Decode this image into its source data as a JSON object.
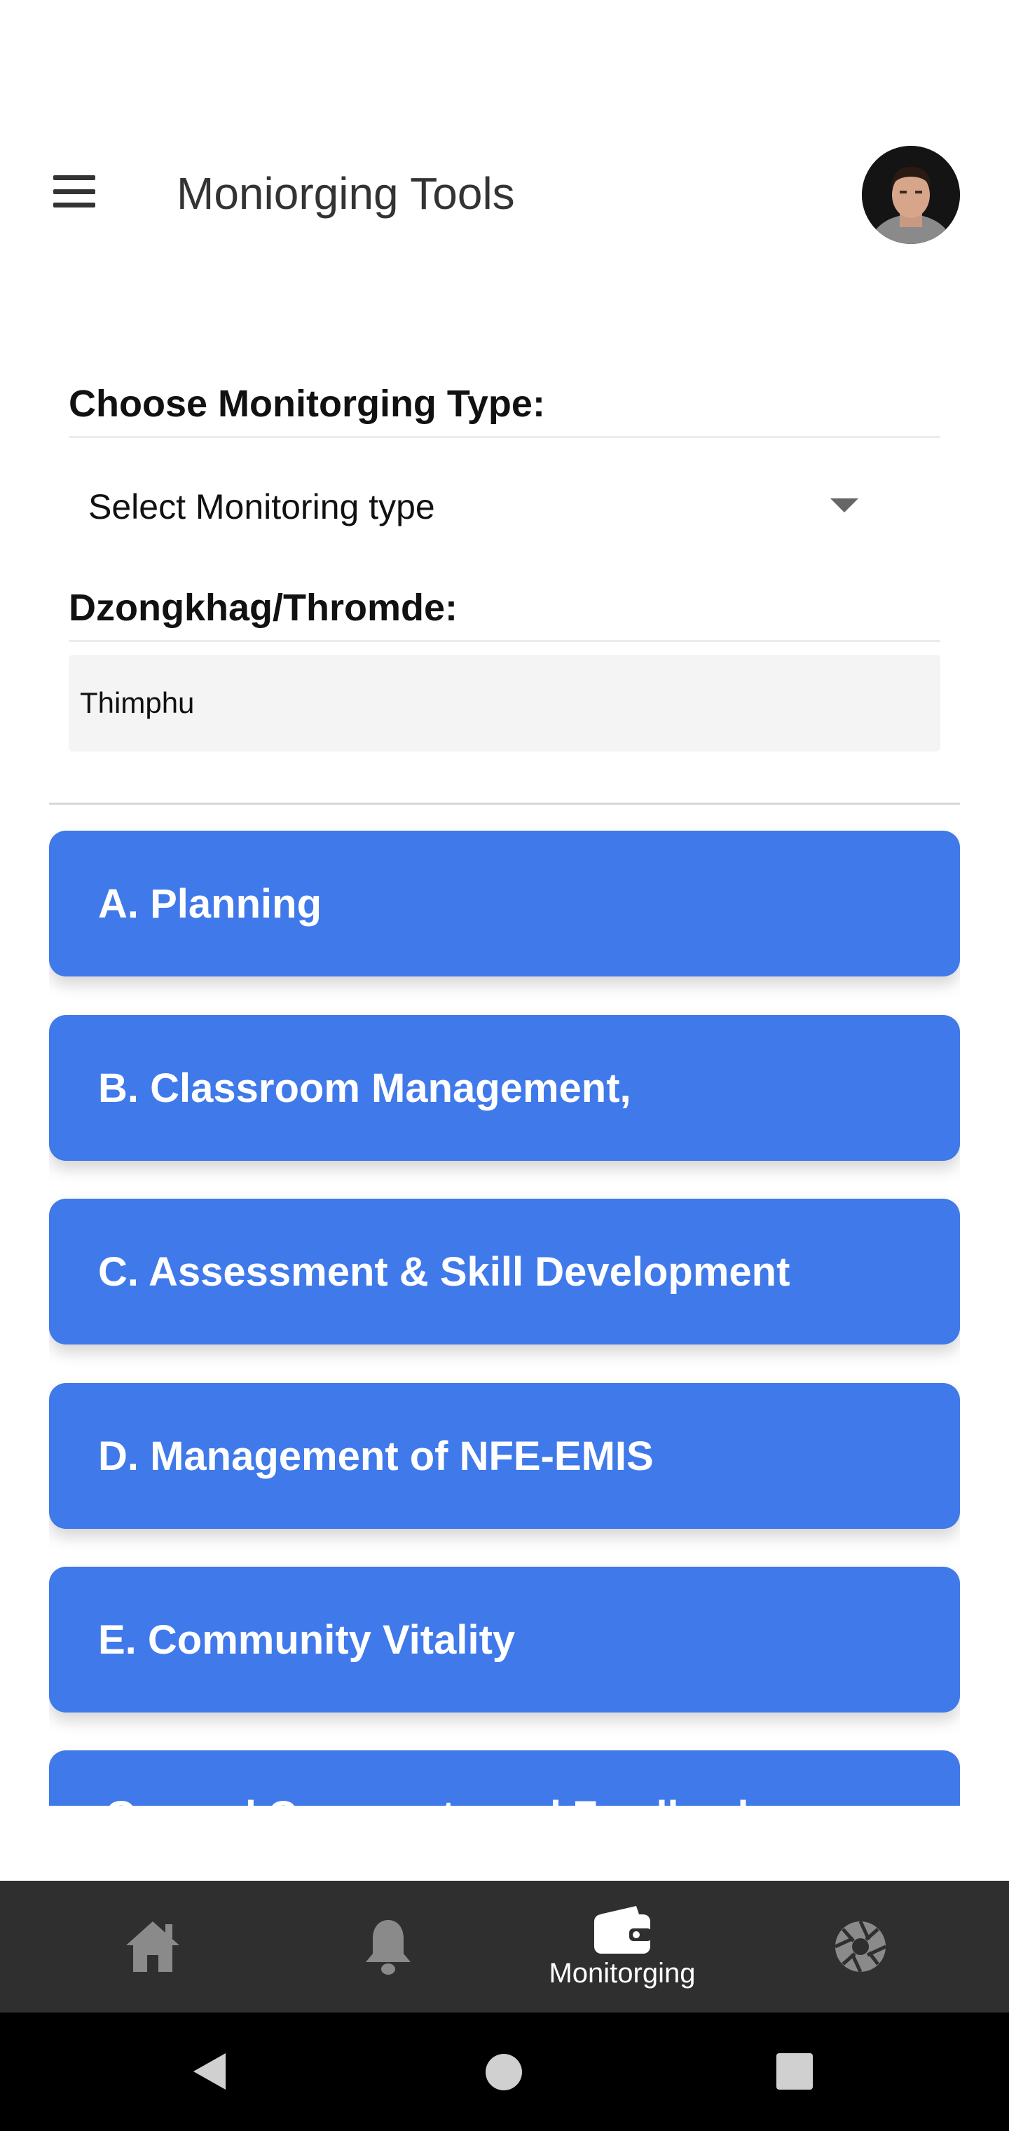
{
  "header": {
    "title": "Moniorging Tools"
  },
  "form": {
    "monitoring_type_label": "Choose Monitorging Type:",
    "monitoring_type_value": "Select Monitoring type",
    "dzongkhag_label": "Dzongkhag/Thromde:",
    "dzongkhag_value": "Thimphu"
  },
  "sections": [
    {
      "label": "A. Planning"
    },
    {
      "label": "B. Classroom Management,"
    },
    {
      "label": "C. Assessment & Skill Development"
    },
    {
      "label": "D. Management of NFE-EMIS"
    },
    {
      "label": "E. Community Vitality"
    },
    {
      "label": "General Comments and Feedback"
    }
  ],
  "bottom_nav": {
    "items": [
      {
        "icon": "home-icon",
        "label": ""
      },
      {
        "icon": "bell-icon",
        "label": ""
      },
      {
        "icon": "wallet-icon",
        "label": "Monitorging"
      },
      {
        "icon": "aperture-icon",
        "label": ""
      }
    ]
  },
  "colors": {
    "accent": "#4079e9",
    "nav_bg": "#2f2f2f",
    "system_bar": "#000000"
  }
}
